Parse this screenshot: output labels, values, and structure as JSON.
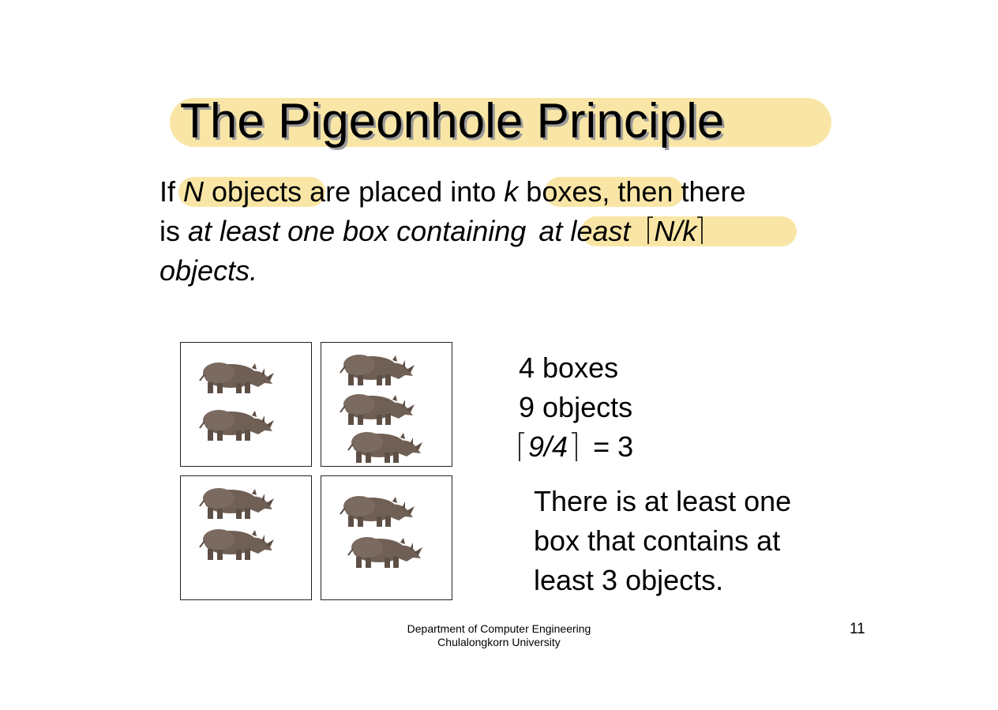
{
  "slide": {
    "title": "The Pigeonhole Principle",
    "definition": {
      "line1": {
        "w1": "If",
        "w2": "N",
        "w3": " objects",
        "w4": " are placed into",
        "w5": "k",
        "w6": " boxes,",
        "w7": " then there"
      },
      "line2": {
        "w1": "is ",
        "w2": "at least one box containing",
        "w3": "at least",
        "w4": "N/k"
      },
      "line3": "objects."
    },
    "example": {
      "boxes_line": "4 boxes",
      "objects_line": "9 objects",
      "ceil_expr": "9/4",
      "result": "= 3",
      "conclusion_line1": "There is at least one",
      "conclusion_line2": "box that contains at",
      "conclusion_line3": "least 3 objects.",
      "box_object_counts": [
        2,
        3,
        2,
        2
      ]
    },
    "footer": {
      "line1": "Department of Computer Engineering",
      "line2": "Chulalongkorn University"
    },
    "page_number": "11",
    "colors": {
      "highlight": "#f9e6a6",
      "title_shadow": "#9a9a9a",
      "rhino_body": "#6f5f55"
    },
    "icons": [
      "rhino-icon"
    ]
  }
}
